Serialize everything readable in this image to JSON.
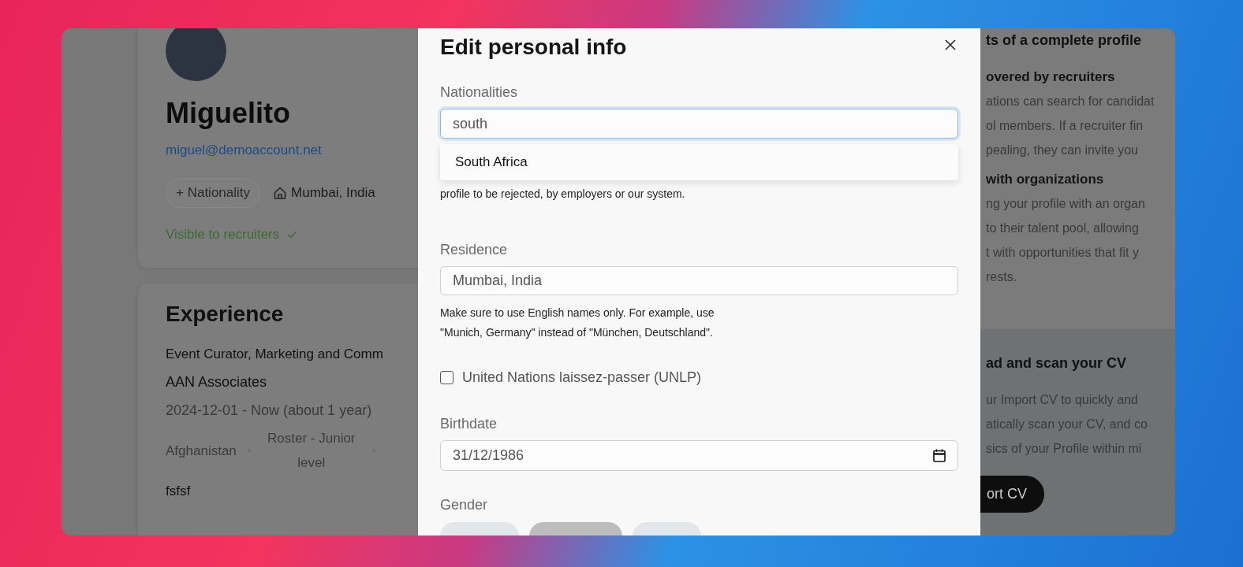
{
  "profile": {
    "name": "Miguelito",
    "email": "miguel@demoaccount.net",
    "nationality_button": "+ Nationality",
    "residence": "Mumbai, India",
    "visibility": "Visible to recruiters"
  },
  "experience": {
    "title": "Experience",
    "role": "Event Curator, Marketing and Comm",
    "company": "AAN Associates",
    "period": "2024-12-01 - Now (about 1 year)",
    "tags": [
      "Afghanistan",
      "Roster - Junior level"
    ],
    "description": "fsfsf"
  },
  "benefits_panel": {
    "title": "ts of a complete profile",
    "sections": [
      {
        "heading": "overed by recruiters",
        "lines": [
          "ations can search for candidat",
          "ol members. If a recruiter fin",
          "pealing, they can invite you"
        ]
      },
      {
        "heading": "with organizations",
        "lines": [
          "ng your profile with an organ",
          "to their talent pool, allowing",
          "t with opportunities that fit y",
          "rests."
        ]
      }
    ]
  },
  "cv_panel": {
    "title": "ad and scan your CV",
    "lines": [
      "ur Import CV to quickly and",
      "atically scan your CV, and co",
      "sics of your Profile within mi"
    ],
    "button": "ort CV"
  },
  "modal": {
    "title": "Edit personal info",
    "fields": [
      {
        "kind": "search",
        "label": "Nationalities",
        "value": "south",
        "focused": true,
        "suggestions": [
          {
            "label": "South Africa"
          }
        ],
        "help": "profile to be rejected, by employers or our system."
      },
      {
        "kind": "text",
        "label": "Residence",
        "value": "Mumbai, India",
        "focused": false,
        "help": "Make sure to use English names only. For example, use \"Munich, Germany\" instead of \"München, Deutschland\"."
      },
      {
        "kind": "checkbox",
        "label": "United Nations laissez-passer (UNLP)",
        "checked": false
      },
      {
        "kind": "date",
        "label": "Birthdate",
        "value": "31/12/1986"
      },
      {
        "kind": "choice",
        "label": "Gender",
        "options": [
          {
            "selected": false
          },
          {
            "selected": true
          },
          {
            "selected": false
          }
        ]
      }
    ]
  }
}
